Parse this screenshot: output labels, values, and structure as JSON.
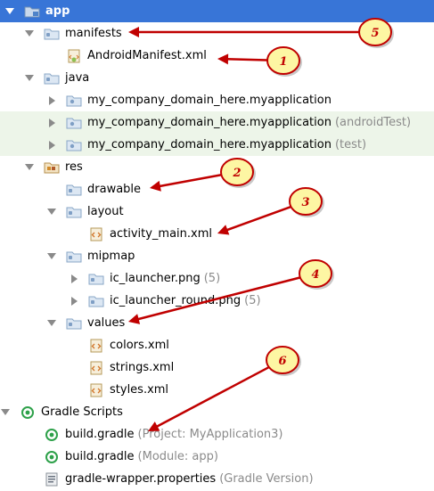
{
  "tree": [
    {
      "id": "app",
      "label": "app",
      "indent": 5,
      "toggle": "down",
      "icon": "module-folder-icon",
      "selected": true
    },
    {
      "id": "manifests",
      "label": "manifests",
      "indent": 27,
      "toggle": "down",
      "icon": "folder-icon"
    },
    {
      "id": "androidmanifest",
      "label": "AndroidManifest.xml",
      "indent": 52,
      "toggle": null,
      "icon": "manifest-file-icon"
    },
    {
      "id": "java",
      "label": "java",
      "indent": 27,
      "toggle": "down",
      "icon": "folder-icon"
    },
    {
      "id": "pkg-main",
      "label": "my_company_domain_here.myapplication",
      "indent": 52,
      "toggle": "right",
      "icon": "package-icon"
    },
    {
      "id": "pkg-androidtest",
      "label": "my_company_domain_here.myapplication",
      "secondary": "(androidTest)",
      "indent": 52,
      "toggle": "right",
      "icon": "package-icon",
      "highlight": true
    },
    {
      "id": "pkg-test",
      "label": "my_company_domain_here.myapplication",
      "secondary": "(test)",
      "indent": 52,
      "toggle": "right",
      "icon": "package-icon",
      "highlight": true
    },
    {
      "id": "res",
      "label": "res",
      "indent": 27,
      "toggle": "down",
      "icon": "resource-folder-icon"
    },
    {
      "id": "drawable",
      "label": "drawable",
      "indent": 52,
      "toggle": null,
      "icon": "folder-icon"
    },
    {
      "id": "layout",
      "label": "layout",
      "indent": 52,
      "toggle": "down",
      "icon": "folder-icon"
    },
    {
      "id": "activity-main",
      "label": "activity_main.xml",
      "indent": 77,
      "toggle": null,
      "icon": "xml-file-icon"
    },
    {
      "id": "mipmap",
      "label": "mipmap",
      "indent": 52,
      "toggle": "down",
      "icon": "folder-icon"
    },
    {
      "id": "ic-launcher",
      "label": "ic_launcher.png",
      "secondary": "(5)",
      "indent": 77,
      "toggle": "right",
      "icon": "folder-icon"
    },
    {
      "id": "ic-launcher-round",
      "label": "ic_launcher_round.png",
      "secondary": "(5)",
      "indent": 77,
      "toggle": "right",
      "icon": "folder-icon"
    },
    {
      "id": "values",
      "label": "values",
      "indent": 52,
      "toggle": "down",
      "icon": "folder-icon"
    },
    {
      "id": "colors",
      "label": "colors.xml",
      "indent": 77,
      "toggle": null,
      "icon": "xml-file-icon"
    },
    {
      "id": "strings",
      "label": "strings.xml",
      "indent": 77,
      "toggle": null,
      "icon": "xml-file-icon"
    },
    {
      "id": "styles",
      "label": "styles.xml",
      "indent": 77,
      "toggle": null,
      "icon": "xml-file-icon"
    },
    {
      "id": "gradle-scripts",
      "label": "Gradle Scripts",
      "indent": 0,
      "toggle": "down",
      "icon": "gradle-icon"
    },
    {
      "id": "build-gradle-project",
      "label": "build.gradle",
      "secondary": "(Project: MyApplication3)",
      "indent": 27,
      "toggle": null,
      "icon": "gradle-icon"
    },
    {
      "id": "build-gradle-module",
      "label": "build.gradle",
      "secondary": "(Module: app)",
      "indent": 27,
      "toggle": null,
      "icon": "gradle-icon"
    },
    {
      "id": "gradle-wrapper",
      "label": "gradle-wrapper.properties",
      "secondary": "(Gradle Version)",
      "indent": 27,
      "toggle": null,
      "icon": "properties-file-icon"
    }
  ],
  "callouts": [
    {
      "number": "5",
      "target": "manifests"
    },
    {
      "number": "1",
      "target": "androidmanifest"
    },
    {
      "number": "2",
      "target": "drawable"
    },
    {
      "number": "3",
      "target": "activity-main"
    },
    {
      "number": "4",
      "target": "values"
    },
    {
      "number": "6",
      "target": "build-gradle-project"
    }
  ],
  "colors": {
    "selection": "#3875d7",
    "highlight": "#edf5e9",
    "folder": "#9fb8d3",
    "callout": "#c00000",
    "callout_fill": "#fdf6a3",
    "gradle": "#2ea14a"
  }
}
